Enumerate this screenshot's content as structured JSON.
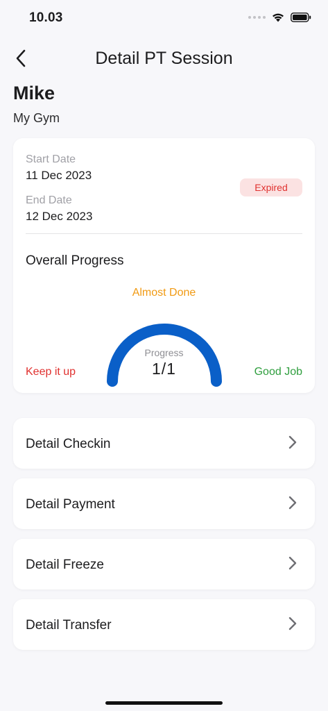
{
  "status_bar": {
    "time": "10.03"
  },
  "header": {
    "title": "Detail PT Session"
  },
  "member": {
    "name": "Mike",
    "gym": "My Gym"
  },
  "session": {
    "start_label": "Start Date",
    "start_date": "11 Dec 2023",
    "end_label": "End Date",
    "end_date": "12 Dec 2023",
    "status": "Expired",
    "status_color": "#e0312f"
  },
  "progress": {
    "heading": "Overall Progress",
    "state": "Almost Done",
    "caption": "Progress",
    "value_text": "1/1",
    "fraction": 1.0,
    "low_label": "Keep it up",
    "high_label": "Good Job",
    "gauge_color": "#0a5fc8"
  },
  "menu": {
    "items": [
      {
        "label": "Detail Checkin"
      },
      {
        "label": "Detail Payment"
      },
      {
        "label": "Detail Freeze"
      },
      {
        "label": "Detail Transfer"
      }
    ]
  }
}
